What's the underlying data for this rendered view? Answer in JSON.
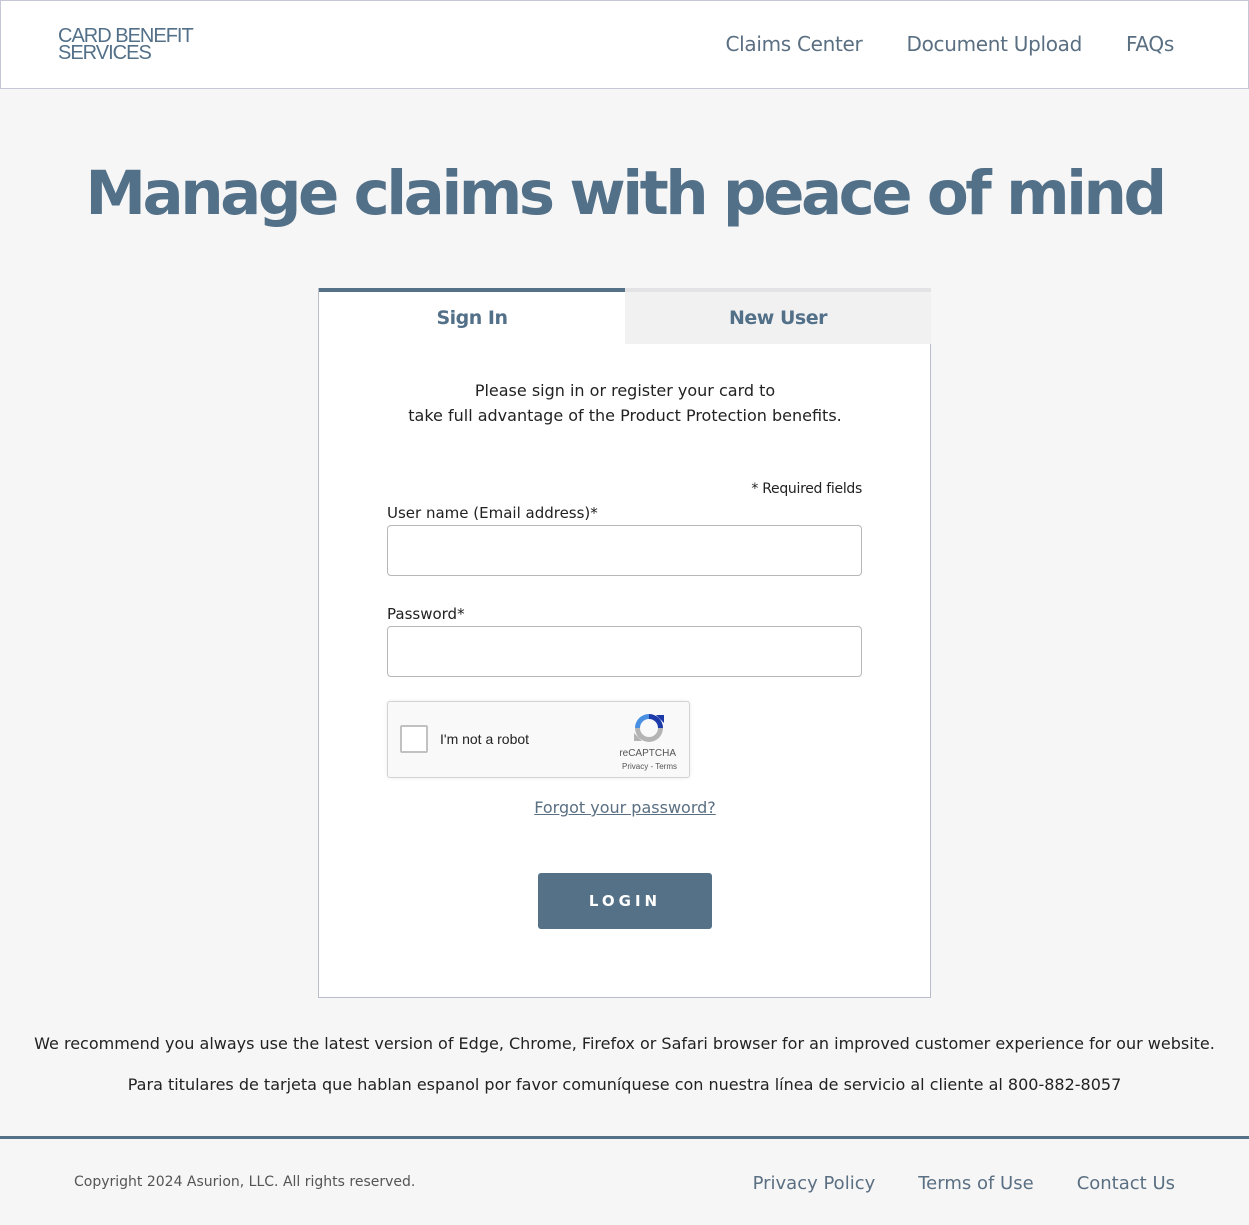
{
  "header": {
    "logo_line1": "CARD BENEFIT",
    "logo_line2": "SERVICES",
    "nav": [
      "Claims Center",
      "Document Upload",
      "FAQs"
    ]
  },
  "hero": {
    "title": "Manage claims with peace of mind"
  },
  "card": {
    "tabs": {
      "sign_in": "Sign In",
      "new_user": "New User"
    },
    "intro_line1": "Please sign in or register your card to",
    "intro_line2": "take full advantage of the Product Protection benefits.",
    "required_note": "* Required fields",
    "username_label": "User name (Email address)*",
    "username_value": "",
    "password_label": "Password*",
    "password_value": "",
    "captcha": {
      "text": "I'm not a robot",
      "brand": "reCAPTCHA",
      "links": "Privacy - Terms"
    },
    "forgot_link": "Forgot your password?",
    "login_button": "LOGIN"
  },
  "notes": {
    "browser": "We recommend you always use the latest version of Edge, Chrome, Firefox or Safari browser for an improved customer experience for our website.",
    "spanish": "Para titulares de tarjeta que hablan espanol por favor comuníquese con nuestra línea de servicio al cliente al 800-882-8057"
  },
  "footer": {
    "copyright": "Copyright 2024 Asurion, LLC. All rights reserved.",
    "links": [
      "Privacy Policy",
      "Terms of Use",
      "Contact Us"
    ]
  },
  "colors": {
    "brand": "#557188",
    "text_link": "#5a6f82"
  }
}
